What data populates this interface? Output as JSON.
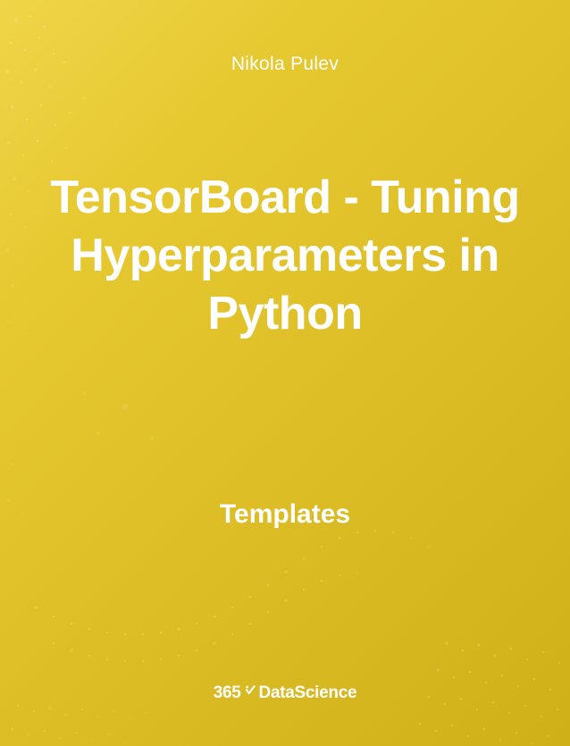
{
  "author": "Nikola Pulev",
  "title": "TensorBoard - Tuning Hyperparameters in Python",
  "subtitle": "Templates",
  "logo": {
    "prefix": "365",
    "suffix": "DataScience"
  }
}
